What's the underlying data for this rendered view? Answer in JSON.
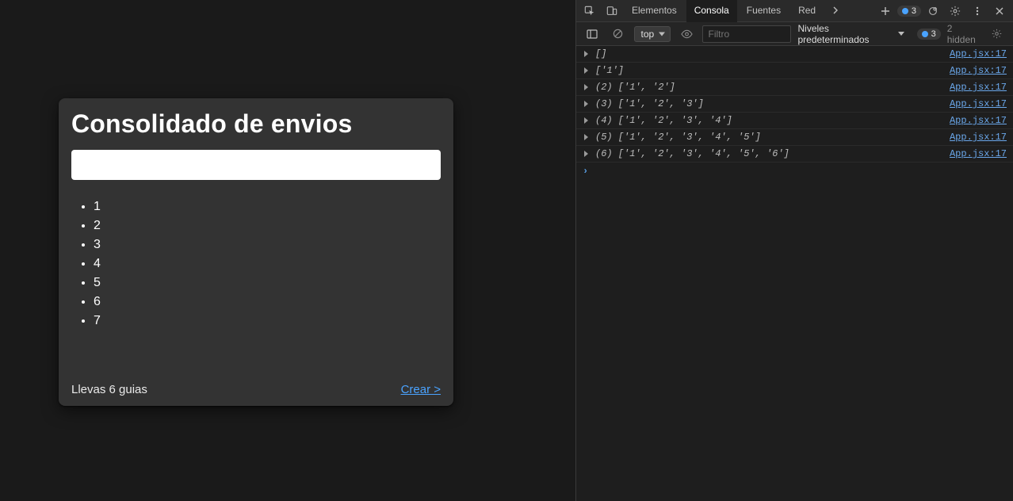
{
  "app": {
    "card": {
      "title": "Consolidado de envios",
      "input_value": "",
      "items": [
        "1",
        "2",
        "3",
        "4",
        "5",
        "6",
        "7"
      ],
      "guias_text": "Llevas 6 guias",
      "create_link": "Crear >"
    }
  },
  "devtools": {
    "tabs": {
      "elements": "Elementos",
      "console": "Consola",
      "sources": "Fuentes",
      "network": "Red",
      "active": "console"
    },
    "top_badge": "3",
    "console_bar": {
      "context": "top",
      "filter_placeholder": "Filtro",
      "levels_label": "Niveles predeterminados",
      "issues_badge": "3",
      "hidden_text": "2 hidden"
    },
    "logs": [
      {
        "text": "[]",
        "source": "App.jsx:17"
      },
      {
        "text": "['1']",
        "source": "App.jsx:17"
      },
      {
        "text": "(2) ['1', '2']",
        "source": "App.jsx:17"
      },
      {
        "text": "(3) ['1', '2', '3']",
        "source": "App.jsx:17"
      },
      {
        "text": "(4) ['1', '2', '3', '4']",
        "source": "App.jsx:17"
      },
      {
        "text": "(5) ['1', '2', '3', '4', '5']",
        "source": "App.jsx:17"
      },
      {
        "text": "(6) ['1', '2', '3', '4', '5', '6']",
        "source": "App.jsx:17"
      }
    ]
  }
}
